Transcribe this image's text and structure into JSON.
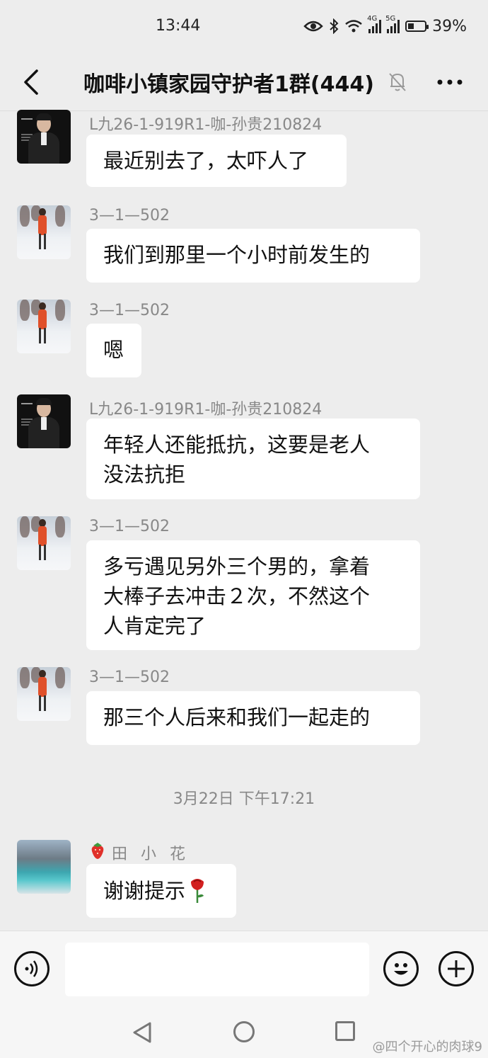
{
  "status_bar": {
    "time": "13:44",
    "net1": "4G",
    "net2": "5G",
    "battery": "39%"
  },
  "header": {
    "title": "咖啡小镇家园守护者1群(444)"
  },
  "messages": [
    {
      "sender": "L九26-1-919R1-咖-孙贵210824",
      "avatar": "man-in-suit",
      "text": "最近别去了，太吓人了"
    },
    {
      "sender": "3—1—502",
      "avatar": "person-on-snow",
      "text": "我们到那里一个小时前发生的"
    },
    {
      "sender": "3—1—502",
      "avatar": "person-on-snow",
      "text": "嗯"
    },
    {
      "sender": "L九26-1-919R1-咖-孙贵210824",
      "avatar": "man-in-suit",
      "lines": [
        "年轻人还能抵抗，这要是老人",
        "没法抗拒"
      ]
    },
    {
      "sender": "3—1—502",
      "avatar": "person-on-snow",
      "lines": [
        "多亏遇见另外三个男的，拿着",
        "大棒子去冲击２次，不然这个",
        "人肯定完了"
      ]
    },
    {
      "sender": "3—1—502",
      "avatar": "person-on-snow",
      "text": "那三个人后来和我们一起走的"
    },
    {
      "sender": "田 小 花",
      "sender_icon": "strawberry-icon",
      "avatar": "lake-landscape",
      "text": "谢谢提示",
      "text_icon": "rose-icon"
    }
  ],
  "timestamp": "3月22日 下午17:21",
  "watermark": "@四个开心的肉球9",
  "colors": {
    "background": "#ededed",
    "bubble": "#ffffff",
    "secondary_text": "#888888"
  }
}
